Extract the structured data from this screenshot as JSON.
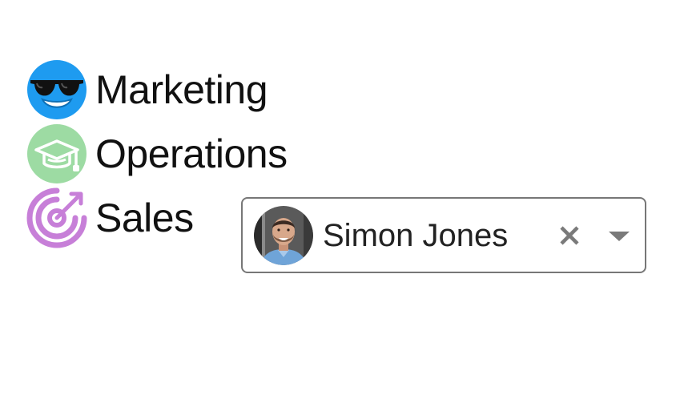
{
  "teams": [
    {
      "label": "Marketing",
      "icon": "sunglasses-emoji-icon",
      "color": "#1E9BF0"
    },
    {
      "label": "Operations",
      "icon": "graduation-cap-icon",
      "color": "#9DDBA3"
    },
    {
      "label": "Sales",
      "icon": "target-icon",
      "color": "#C77FD8"
    }
  ],
  "user_select": {
    "selected_name": "Simon Jones",
    "avatar": "avatar",
    "clear_icon": "close-icon",
    "dropdown_icon": "chevron-down-icon",
    "clear_color": "#7A7A7A",
    "dropdown_color": "#7A7A7A",
    "border_color": "#777777"
  }
}
